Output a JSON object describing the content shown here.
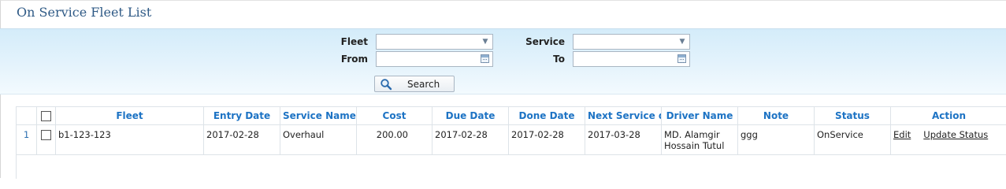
{
  "page": {
    "title": "On Service Fleet List"
  },
  "filters": {
    "fleet_label": "Fleet",
    "service_label": "Service",
    "from_label": "From",
    "to_label": "To",
    "fleet_value": "",
    "service_value": "",
    "from_value": "",
    "to_value": "",
    "search_label": "Search"
  },
  "table": {
    "columns": [
      "Fleet",
      "Entry Date",
      "Service Name",
      "Cost",
      "Due Date",
      "Done Date",
      "Next Service dat",
      "Driver Name",
      "Note",
      "Status",
      "Action"
    ],
    "rows": [
      {
        "index": "1",
        "fleet": "b1-123-123",
        "entry_date": "2017-02-28",
        "service_name": "Overhaul",
        "cost": "200.00",
        "due_date": "2017-02-28",
        "done_date": "2017-02-28",
        "next_service_date": "2017-03-28",
        "driver_name": "MD. Alamgir Hossain Tutul",
        "note": "ggg",
        "status": "OnService",
        "edit_label": "Edit",
        "update_label": "Update Status"
      }
    ]
  },
  "colors": {
    "title": "#2f5a86",
    "header_text": "#1d73c4",
    "status_on": "#1a9a1a",
    "panel_bg": "#d4ecfa"
  }
}
